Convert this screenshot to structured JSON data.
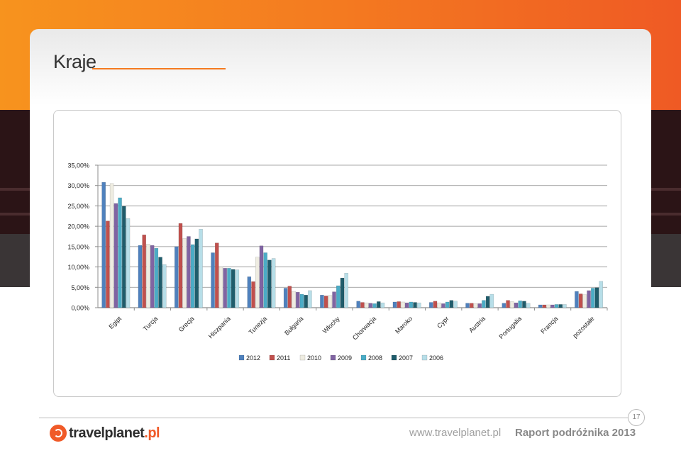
{
  "slide": {
    "title": "Kraje",
    "page_number": "17",
    "footer_url": "www.travelplanet.pl",
    "footer_report": "Raport podróżnika 2013",
    "logo_main": "travelplanet",
    "logo_suffix": ".pl"
  },
  "colors": {
    "accent": "#f47a20",
    "series": [
      "#4f81bd",
      "#c0504d",
      "#eeece1",
      "#8064a2",
      "#4bacc6",
      "#1f5c6b",
      "#b7dee8"
    ]
  },
  "chart_data": {
    "type": "bar",
    "categories": [
      "Egipt",
      "Turcja",
      "Grecja",
      "Hiszpania",
      "Tunezja",
      "Bułgaria",
      "Włochy",
      "Chorwacja",
      "Maroko",
      "Cypr",
      "Austria",
      "Portugalia",
      "Francja",
      "pozostałe"
    ],
    "yticks": [
      "35,00%",
      "30,00%",
      "25,00%",
      "20,00%",
      "15,00%",
      "10,00%",
      "5,00%",
      "0,00%"
    ],
    "ylim": [
      0,
      35
    ],
    "grid": true,
    "legend_position": "bottom",
    "series": [
      {
        "name": "2012",
        "values": [
          30.8,
          15.3,
          15.0,
          13.5,
          7.6,
          4.8,
          3.1,
          1.6,
          1.4,
          1.3,
          1.1,
          1.1,
          0.7,
          4.0
        ]
      },
      {
        "name": "2011",
        "values": [
          21.3,
          17.9,
          20.7,
          15.9,
          6.4,
          5.3,
          2.9,
          1.3,
          1.5,
          1.6,
          1.1,
          1.8,
          0.7,
          3.4
        ]
      },
      {
        "name": "2010",
        "values": [
          30.5,
          15.6,
          17.0,
          10.0,
          12.4,
          4.0,
          3.0,
          1.2,
          1.4,
          1.2,
          1.0,
          1.5,
          0.7,
          3.2
        ]
      },
      {
        "name": "2009",
        "values": [
          25.6,
          15.3,
          17.5,
          9.7,
          15.2,
          3.8,
          3.9,
          1.1,
          1.2,
          1.0,
          1.0,
          1.2,
          0.7,
          4.2
        ]
      },
      {
        "name": "2008",
        "values": [
          27.0,
          14.6,
          15.5,
          9.7,
          13.5,
          3.3,
          5.4,
          1.0,
          1.4,
          1.4,
          1.8,
          1.7,
          0.8,
          4.8
        ]
      },
      {
        "name": "2007",
        "values": [
          24.9,
          12.4,
          16.9,
          9.4,
          11.7,
          3.1,
          7.3,
          1.5,
          1.3,
          1.8,
          2.8,
          1.6,
          0.8,
          4.9
        ]
      },
      {
        "name": "2006",
        "values": [
          21.9,
          10.6,
          19.3,
          9.3,
          12.1,
          4.2,
          8.5,
          1.2,
          1.2,
          1.6,
          3.3,
          1.1,
          0.8,
          6.5
        ]
      }
    ]
  }
}
